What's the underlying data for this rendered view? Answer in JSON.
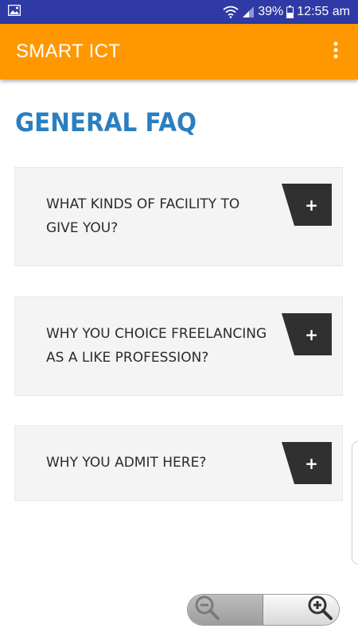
{
  "status_bar": {
    "battery": "39%",
    "time": "12:55 am",
    "icons": [
      "image-icon",
      "wifi-icon",
      "signal-icon",
      "battery-icon"
    ]
  },
  "app_bar": {
    "title": "SMART ICT",
    "menu_icon": "overflow-menu-icon",
    "background_color": "#ff9800"
  },
  "page": {
    "title": "GENERAL FAQ",
    "title_color": "#2a7fc0"
  },
  "faqs": [
    {
      "question": "WHAT KINDS OF FACILITY TO\nGIVE YOU?",
      "toggle": "+"
    },
    {
      "question": "WHY YOU CHOICE FREELANCING\nAS A LIKE PROFESSION?",
      "toggle": "+"
    },
    {
      "question": "WHY YOU ADMIT HERE?",
      "toggle": "+"
    }
  ],
  "zoom_control": {
    "zoom_out_icon": "zoom-out-icon",
    "zoom_in_icon": "zoom-in-icon"
  }
}
